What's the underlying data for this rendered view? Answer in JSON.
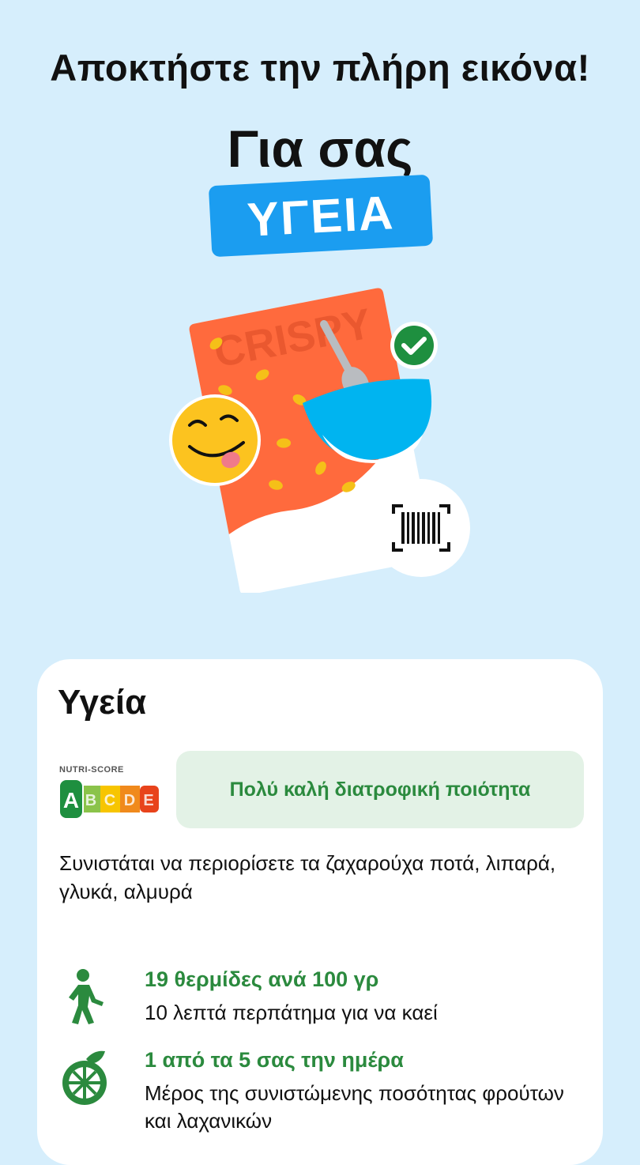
{
  "header": {
    "headline": "Αποκτήστε την πλήρη εικόνα!",
    "subheadline": "Για σας",
    "badge": "ΥΓΕΙΑ"
  },
  "illustration": {
    "box_text": "CRISPY",
    "icons": [
      "smiley-tongue-icon",
      "check-circle-icon",
      "barcode-scan-icon",
      "spoon-icon"
    ]
  },
  "card": {
    "title": "Υγεία",
    "nutriscore": {
      "label": "NUTRI-SCORE",
      "grades": [
        "A",
        "B",
        "C",
        "D",
        "E"
      ],
      "selected": "A",
      "colors": [
        "#1e8f3f",
        "#8bc34a",
        "#f7c500",
        "#f08a1c",
        "#e8431b"
      ]
    },
    "quality_label": "Πολύ καλή διατροφική ποιότητα",
    "recommendation": "Συνιστάται να περιορίσετε τα ζαχαρούχα ποτά, λιπαρά, γλυκά, αλμυρά",
    "facts": [
      {
        "icon": "walking-person-icon",
        "title": "19 θερμίδες ανά 100 γρ",
        "description": "10 λεπτά περπάτημα για να καεί"
      },
      {
        "icon": "fruit-slice-icon",
        "title": "1 από τα 5 σας την ημέρα",
        "description": "Μέρος της συνιστώμενης ποσότητας φρούτων και λαχανικών"
      }
    ]
  },
  "colors": {
    "background": "#d6eefc",
    "accent_blue": "#1b9df0",
    "green": "#2b8a3e",
    "pill_bg": "#e3f2e6"
  }
}
